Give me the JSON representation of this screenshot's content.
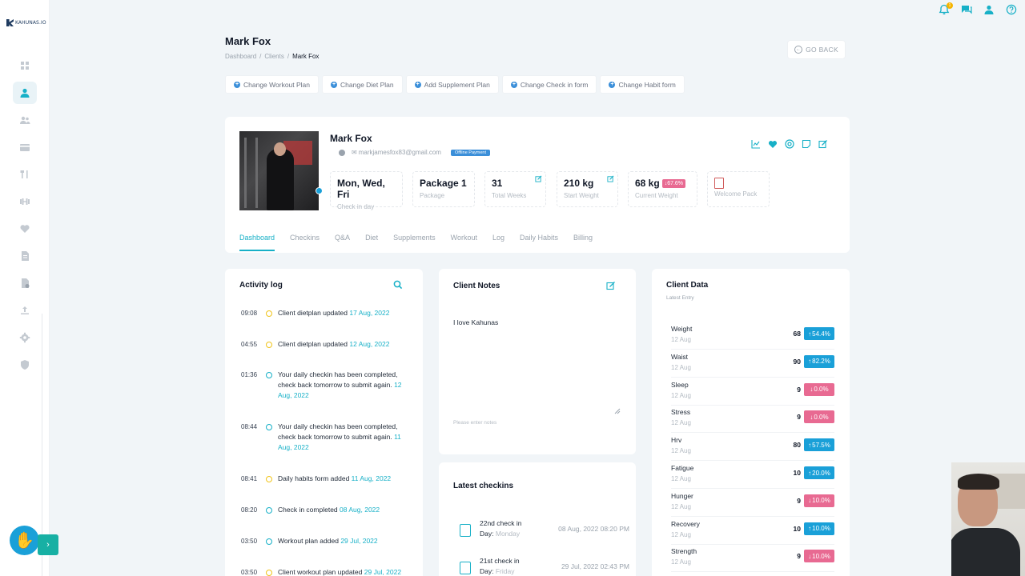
{
  "brand": {
    "name": "KAHUNAS.IO"
  },
  "header": {
    "title": "Mark Fox",
    "breadcrumb": [
      "Dashboard",
      "/",
      "Clients",
      "/",
      "Mark Fox"
    ],
    "go_back": "GO BACK"
  },
  "actions": [
    "Change Workout Plan",
    "Change Diet Plan",
    "Add Supplement Plan",
    "Change Check in form",
    "Change Habit form"
  ],
  "top_bar": {
    "notification_count": "1"
  },
  "profile": {
    "name": "Mark Fox",
    "email": "markjamesfox83@gmail.com",
    "payment_badge": "Offline Payment",
    "stats": {
      "checkin_day": {
        "value": "Mon, Wed, Fri",
        "label": "Check in day"
      },
      "package": {
        "value": "Package 1",
        "label": "Package"
      },
      "weeks": {
        "value": "31",
        "label": "Total Weeks"
      },
      "start_weight": {
        "value": "210 kg",
        "label": "Start Weight"
      },
      "current_weight": {
        "value": "68 kg",
        "label": "Current Weight",
        "change": "67.6%"
      },
      "welcome": {
        "label": "Welcome Pack"
      }
    }
  },
  "tabs": [
    "Dashboard",
    "Checkins",
    "Q&A",
    "Diet",
    "Supplements",
    "Workout",
    "Log",
    "Daily Habits",
    "Billing"
  ],
  "activity": {
    "title": "Activity log",
    "items": [
      {
        "time": "09:08",
        "text": "Client dietplan updated",
        "date": "17 Aug, 2022",
        "color": "#f0c419"
      },
      {
        "time": "04:55",
        "text": "Client dietplan updated",
        "date": "12 Aug, 2022",
        "color": "#f0c419"
      },
      {
        "time": "01:36",
        "text": "Your daily checkin has been completed, check back tomorrow to submit again.",
        "date": "12 Aug, 2022",
        "color": "#17b0c7"
      },
      {
        "time": "08:44",
        "text": "Your daily checkin has been completed, check back tomorrow to submit again.",
        "date": "11 Aug, 2022",
        "color": "#17b0c7"
      },
      {
        "time": "08:41",
        "text": "Daily habits form added",
        "date": "11 Aug, 2022",
        "color": "#f0c419"
      },
      {
        "time": "08:20",
        "text": "Check in completed",
        "date": "08 Aug, 2022",
        "color": "#17b0c7"
      },
      {
        "time": "03:50",
        "text": "Workout plan added",
        "date": "29 Jul, 2022",
        "color": "#17b0c7"
      },
      {
        "time": "03:50",
        "text": "Client workout plan updated",
        "date": "29 Jul, 2022",
        "color": "#f0c419"
      }
    ]
  },
  "notes": {
    "title": "Client Notes",
    "text": "I love Kahunas",
    "placeholder": "Please enter notes"
  },
  "checkins": {
    "title": "Latest checkins",
    "items": [
      {
        "title": "22nd check in",
        "day_label": "Day:",
        "day": "Monday",
        "date": "08 Aug, 2022 08:20 PM"
      },
      {
        "title": "21st check in",
        "day_label": "Day:",
        "day": "Friday",
        "date": "29 Jul, 2022 02:43 PM"
      }
    ]
  },
  "client_data": {
    "title": "Client Data",
    "subtitle": "Latest Entry",
    "rows": [
      {
        "name": "Weight",
        "date": "12 Aug",
        "value": "68",
        "change": "54.4%",
        "dir": "up"
      },
      {
        "name": "Waist",
        "date": "12 Aug",
        "value": "90",
        "change": "82.2%",
        "dir": "up"
      },
      {
        "name": "Sleep",
        "date": "12 Aug",
        "value": "9",
        "change": "0.0%",
        "dir": "down"
      },
      {
        "name": "Stress",
        "date": "12 Aug",
        "value": "9",
        "change": "0.0%",
        "dir": "down"
      },
      {
        "name": "Hrv",
        "date": "12 Aug",
        "value": "80",
        "change": "57.5%",
        "dir": "up"
      },
      {
        "name": "Fatigue",
        "date": "12 Aug",
        "value": "10",
        "change": "20.0%",
        "dir": "up"
      },
      {
        "name": "Hunger",
        "date": "12 Aug",
        "value": "9",
        "change": "10.0%",
        "dir": "down"
      },
      {
        "name": "Recovery",
        "date": "12 Aug",
        "value": "10",
        "change": "10.0%",
        "dir": "up"
      },
      {
        "name": "Strength",
        "date": "12 Aug",
        "value": "9",
        "change": "10.0%",
        "dir": "down"
      }
    ]
  },
  "colors": {
    "accent": "#17b0c7",
    "up": "#1aa0d8",
    "down": "#e86a92",
    "primary": "#3b8fd9"
  }
}
